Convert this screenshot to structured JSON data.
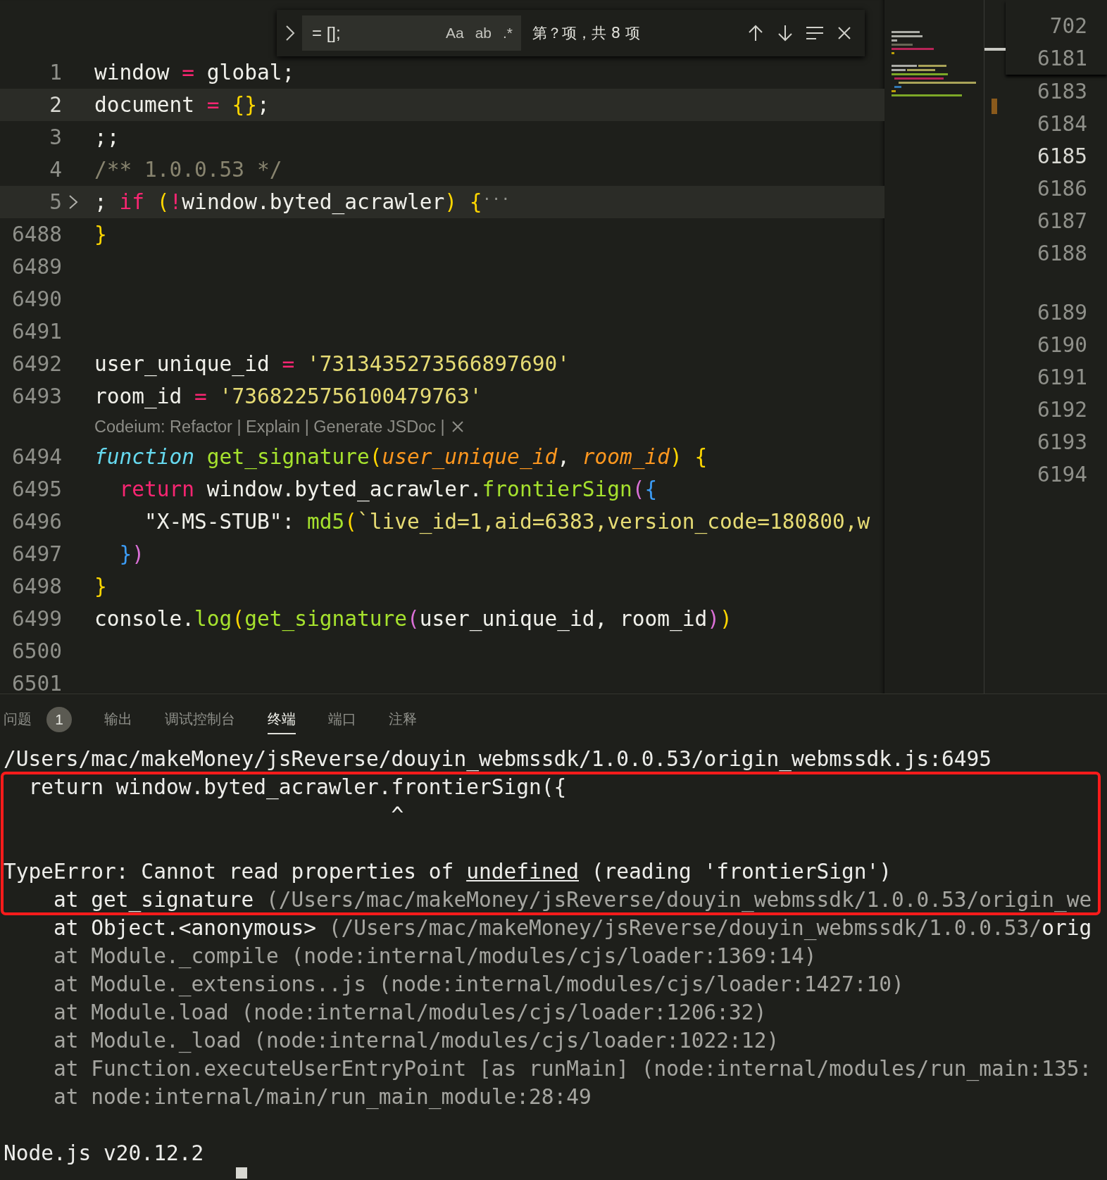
{
  "find_widget": {
    "query": "= [];",
    "toggles": [
      "Aa",
      "ab",
      ".*"
    ],
    "result": "第？项，共 8 项"
  },
  "editor": {
    "lines": [
      {
        "kind": "code",
        "number": "1",
        "current": false,
        "folded": false,
        "tokens": [
          {
            "text": "window ",
            "kind": "plain"
          },
          {
            "text": "=",
            "kind": "op"
          },
          {
            "text": " global;",
            "kind": "plain"
          }
        ]
      },
      {
        "kind": "code",
        "number": "2",
        "current": true,
        "folded": false,
        "tokens": [
          {
            "text": "document ",
            "kind": "plain"
          },
          {
            "text": "=",
            "kind": "op"
          },
          {
            "text": " {}",
            "kind": "brace1"
          },
          {
            "text": ";",
            "kind": "plain"
          }
        ]
      },
      {
        "kind": "code",
        "number": "3",
        "current": false,
        "folded": false,
        "tokens": [
          {
            "text": ";;",
            "kind": "plain"
          }
        ]
      },
      {
        "kind": "code",
        "number": "4",
        "current": false,
        "folded": false,
        "tokens": [
          {
            "text": "/** 1.0.0.53 */",
            "kind": "comment"
          }
        ]
      },
      {
        "kind": "code",
        "number": "5",
        "current": false,
        "folded": true,
        "tokens": [
          {
            "text": ";",
            "kind": "plain"
          },
          {
            "text": " if",
            "kind": "keyword"
          },
          {
            "text": " (",
            "kind": "brace1"
          },
          {
            "text": "!",
            "kind": "op"
          },
          {
            "text": "window.byted_acrawler",
            "kind": "plain"
          },
          {
            "text": ")",
            "kind": "brace1"
          },
          {
            "text": " {",
            "kind": "brace1"
          },
          {
            "text": "···",
            "kind": "ellipsis"
          }
        ]
      },
      {
        "kind": "code",
        "number": "6488",
        "current": false,
        "folded": false,
        "tokens": [
          {
            "text": "}",
            "kind": "brace1"
          }
        ]
      },
      {
        "kind": "code",
        "number": "6489",
        "current": false,
        "folded": false
      },
      {
        "kind": "code",
        "number": "6490",
        "current": false,
        "folded": false
      },
      {
        "kind": "code",
        "number": "6491",
        "current": false,
        "folded": false
      },
      {
        "kind": "code",
        "number": "6492",
        "current": false,
        "folded": false,
        "tokens": [
          {
            "text": "user_unique_id ",
            "kind": "plain"
          },
          {
            "text": "=",
            "kind": "op"
          },
          {
            "text": " '7313435273566897690'",
            "kind": "string"
          }
        ]
      },
      {
        "kind": "code",
        "number": "6493",
        "current": false,
        "folded": false,
        "tokens": [
          {
            "text": "room_id ",
            "kind": "plain"
          },
          {
            "text": "=",
            "kind": "op"
          },
          {
            "text": " '7368225756100479763'",
            "kind": "string"
          }
        ]
      },
      {
        "kind": "codelens",
        "text": "Codeium: Refactor | Explain | Generate JSDoc |"
      },
      {
        "kind": "code",
        "number": "6494",
        "current": false,
        "folded": false,
        "tokens": [
          {
            "text": "function",
            "kind": "storage"
          },
          {
            "text": " get_signature",
            "kind": "fn"
          },
          {
            "text": "(",
            "kind": "brace1"
          },
          {
            "text": "user_unique_id",
            "kind": "param"
          },
          {
            "text": ",",
            "kind": "plain"
          },
          {
            "text": " room_id",
            "kind": "param"
          },
          {
            "text": ")",
            "kind": "brace1"
          },
          {
            "text": " {",
            "kind": "brace1"
          }
        ]
      },
      {
        "kind": "code",
        "number": "6495",
        "current": false,
        "folded": false,
        "tokens": [
          {
            "text": "  return",
            "kind": "keyword"
          },
          {
            "text": " window.byted_acrawler.",
            "kind": "plain"
          },
          {
            "text": "frontierSign",
            "kind": "fn"
          },
          {
            "text": "(",
            "kind": "brace2"
          },
          {
            "text": "{",
            "kind": "brace3"
          }
        ]
      },
      {
        "kind": "code",
        "number": "6496",
        "current": false,
        "folded": false,
        "tokens": [
          {
            "text": "    \"X-MS-STUB\": ",
            "kind": "plain"
          },
          {
            "text": "md5",
            "kind": "fn"
          },
          {
            "text": "(",
            "kind": "brace1"
          },
          {
            "text": "`live_id=1,aid=6383,version_code=180800,w",
            "kind": "string"
          }
        ]
      },
      {
        "kind": "code",
        "number": "6497",
        "current": false,
        "folded": false,
        "tokens": [
          {
            "text": "  }",
            "kind": "brace3"
          },
          {
            "text": ")",
            "kind": "brace2"
          }
        ]
      },
      {
        "kind": "code",
        "number": "6498",
        "current": false,
        "folded": false,
        "tokens": [
          {
            "text": "}",
            "kind": "brace1"
          }
        ]
      },
      {
        "kind": "code",
        "number": "6499",
        "current": false,
        "folded": false,
        "tokens": [
          {
            "text": "console.",
            "kind": "plain"
          },
          {
            "text": "log",
            "kind": "fn"
          },
          {
            "text": "(",
            "kind": "brace1"
          },
          {
            "text": "get_signature",
            "kind": "fn"
          },
          {
            "text": "(",
            "kind": "brace2"
          },
          {
            "text": "user_unique_id, room_id",
            "kind": "plain"
          },
          {
            "text": ")",
            "kind": "brace2"
          },
          {
            "text": ")",
            "kind": "brace1"
          }
        ]
      },
      {
        "kind": "code",
        "number": "6500",
        "current": false,
        "folded": false
      },
      {
        "kind": "code",
        "number": "6501",
        "current": false,
        "folded": false
      }
    ]
  },
  "side_editor": {
    "line_numbers": [
      {
        "kind": "sticky",
        "number": "702",
        "current": false
      },
      {
        "kind": "sticky",
        "number": "6181",
        "current": false
      },
      {
        "kind": "line",
        "number": "6183",
        "current": false
      },
      {
        "kind": "line",
        "number": "6184",
        "current": false
      },
      {
        "kind": "line",
        "number": "6185",
        "current": true
      },
      {
        "kind": "line",
        "number": "6186",
        "current": false
      },
      {
        "kind": "line",
        "number": "6187",
        "current": false
      },
      {
        "kind": "line",
        "number": "6188",
        "current": false
      },
      {
        "kind": "lens_gap"
      },
      {
        "kind": "line",
        "number": "6189",
        "current": false
      },
      {
        "kind": "line",
        "number": "6190",
        "current": false
      },
      {
        "kind": "line",
        "number": "6191",
        "current": false
      },
      {
        "kind": "line",
        "number": "6192",
        "current": false
      },
      {
        "kind": "line",
        "number": "6193",
        "current": false
      },
      {
        "kind": "line",
        "number": "6194",
        "current": false
      }
    ]
  },
  "panel": {
    "tabs": [
      {
        "label": "问题",
        "badge": "1",
        "selected": false
      },
      {
        "label": "输出",
        "selected": false
      },
      {
        "label": "调试控制台",
        "selected": false
      },
      {
        "label": "终端",
        "selected": true
      },
      {
        "label": "端口",
        "selected": false
      },
      {
        "label": "注释",
        "selected": false
      }
    ]
  },
  "terminal": {
    "lines": [
      {
        "kind": "output",
        "segments": [
          {
            "text": "/Users/mac/makeMoney/jsReverse/douyin_webmssdk/1.0.0.53/origin_webmssdk.js:6495",
            "kind": "text"
          }
        ]
      },
      {
        "kind": "output",
        "segments": [
          {
            "text": "  return window.byted_acrawler.frontierSign({",
            "kind": "text"
          }
        ]
      },
      {
        "kind": "output",
        "segments": [
          {
            "text": "                               ^",
            "kind": "text"
          }
        ]
      },
      {
        "kind": "blank"
      },
      {
        "kind": "output",
        "segments": [
          {
            "text": "TypeError: Cannot read properties of ",
            "kind": "text"
          },
          {
            "text": "undefined",
            "kind": "underline"
          },
          {
            "text": " (reading 'frontierSign')",
            "kind": "text"
          }
        ]
      },
      {
        "kind": "output",
        "segments": [
          {
            "text": "    at get_signature ",
            "kind": "text"
          },
          {
            "text": "(/Users/mac/makeMoney/jsReverse/douyin_webmssdk/1.0.0.53/origin_we",
            "kind": "dim"
          }
        ]
      },
      {
        "kind": "output",
        "segments": [
          {
            "text": "    at Object.<anonymous> ",
            "kind": "text"
          },
          {
            "text": "(/Users/mac/makeMoney/jsReverse/douyin_webmssdk/1.0.0.53/",
            "kind": "dim"
          },
          {
            "text": "orig",
            "kind": "text"
          }
        ]
      },
      {
        "kind": "output",
        "segments": [
          {
            "text": "    at Module._compile (node:internal/modules/cjs/loader:1369:14)",
            "kind": "dim"
          }
        ]
      },
      {
        "kind": "output",
        "segments": [
          {
            "text": "    at Module._extensions..js (node:internal/modules/cjs/loader:1427:10)",
            "kind": "dim"
          }
        ]
      },
      {
        "kind": "output",
        "segments": [
          {
            "text": "    at Module.load (node:internal/modules/cjs/loader:1206:32)",
            "kind": "dim"
          }
        ]
      },
      {
        "kind": "output",
        "segments": [
          {
            "text": "    at Module._load (node:internal/modules/cjs/loader:1022:12)",
            "kind": "dim"
          }
        ]
      },
      {
        "kind": "output",
        "segments": [
          {
            "text": "    at Function.executeUserEntryPoint [as runMain] (node:internal/modules/run_main:135:",
            "kind": "dim"
          }
        ]
      },
      {
        "kind": "output",
        "segments": [
          {
            "text": "    at node:internal/main/run_main_module:28:49",
            "kind": "dim"
          }
        ]
      },
      {
        "kind": "blank"
      },
      {
        "kind": "output",
        "segments": [
          {
            "text": "Node.js v20.12.2",
            "kind": "text"
          }
        ]
      }
    ]
  }
}
